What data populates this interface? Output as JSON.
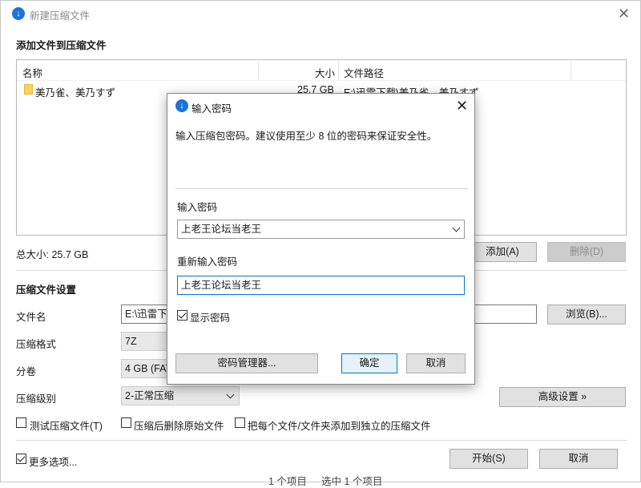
{
  "main_window": {
    "title": "新建压缩文件",
    "section_add": "添加文件到压缩文件",
    "columns": {
      "name": "名称",
      "size": "大小",
      "path": "文件路径"
    },
    "rows": [
      {
        "name": "美乃雀、美乃すず",
        "size": "25.7 GB",
        "path": "E:\\迅雷下载\\美乃雀、美乃すず"
      }
    ],
    "total_size": "总大小: 25.7 GB",
    "add_button": "添加(A)",
    "delete_button": "删除(D)",
    "section_settings": "压缩文件设置",
    "filename_label": "文件名",
    "filename_value": "E:\\迅雷下载",
    "browse_button": "浏览(B)...",
    "format_label": "压缩格式",
    "format_value": "7Z",
    "split_label": "分卷",
    "split_value": "4 GB (FAT",
    "level_label": "压缩级别",
    "level_value": "2-正常压缩",
    "advanced_button": "高级设置 »",
    "checkbox_test": "测试压缩文件(T)",
    "checkbox_delete": "压缩后删除原始文件",
    "checkbox_each": "把每个文件/文件夹添加到独立的压缩文件",
    "more_options": "更多选项...",
    "start_button": "开始(S)",
    "cancel_button": "取消"
  },
  "background_status": {
    "left": "1 个项目",
    "right": "选中 1 个项目"
  },
  "password_dialog": {
    "title": "输入密码",
    "description": "输入压缩包密码。建议使用至少 8 位的密码来保证安全性。",
    "password_label": "输入密码",
    "password_value": "上老王论坛当老王",
    "reenter_label": "重新输入密码",
    "reenter_value": "上老王论坛当老王",
    "show_password": "显示密码",
    "manager_button": "密码管理器...",
    "ok_button": "确定",
    "cancel_button": "取消"
  },
  "colors": {
    "accent": "#0078d7",
    "app_icon": "#1a73d9",
    "folder": "#f6d260"
  },
  "icons": {
    "app": "app-logo-icon",
    "close": "close-icon",
    "folder": "folder-icon",
    "dropdown": "chevron-down-icon",
    "check": "checkmark-icon"
  }
}
